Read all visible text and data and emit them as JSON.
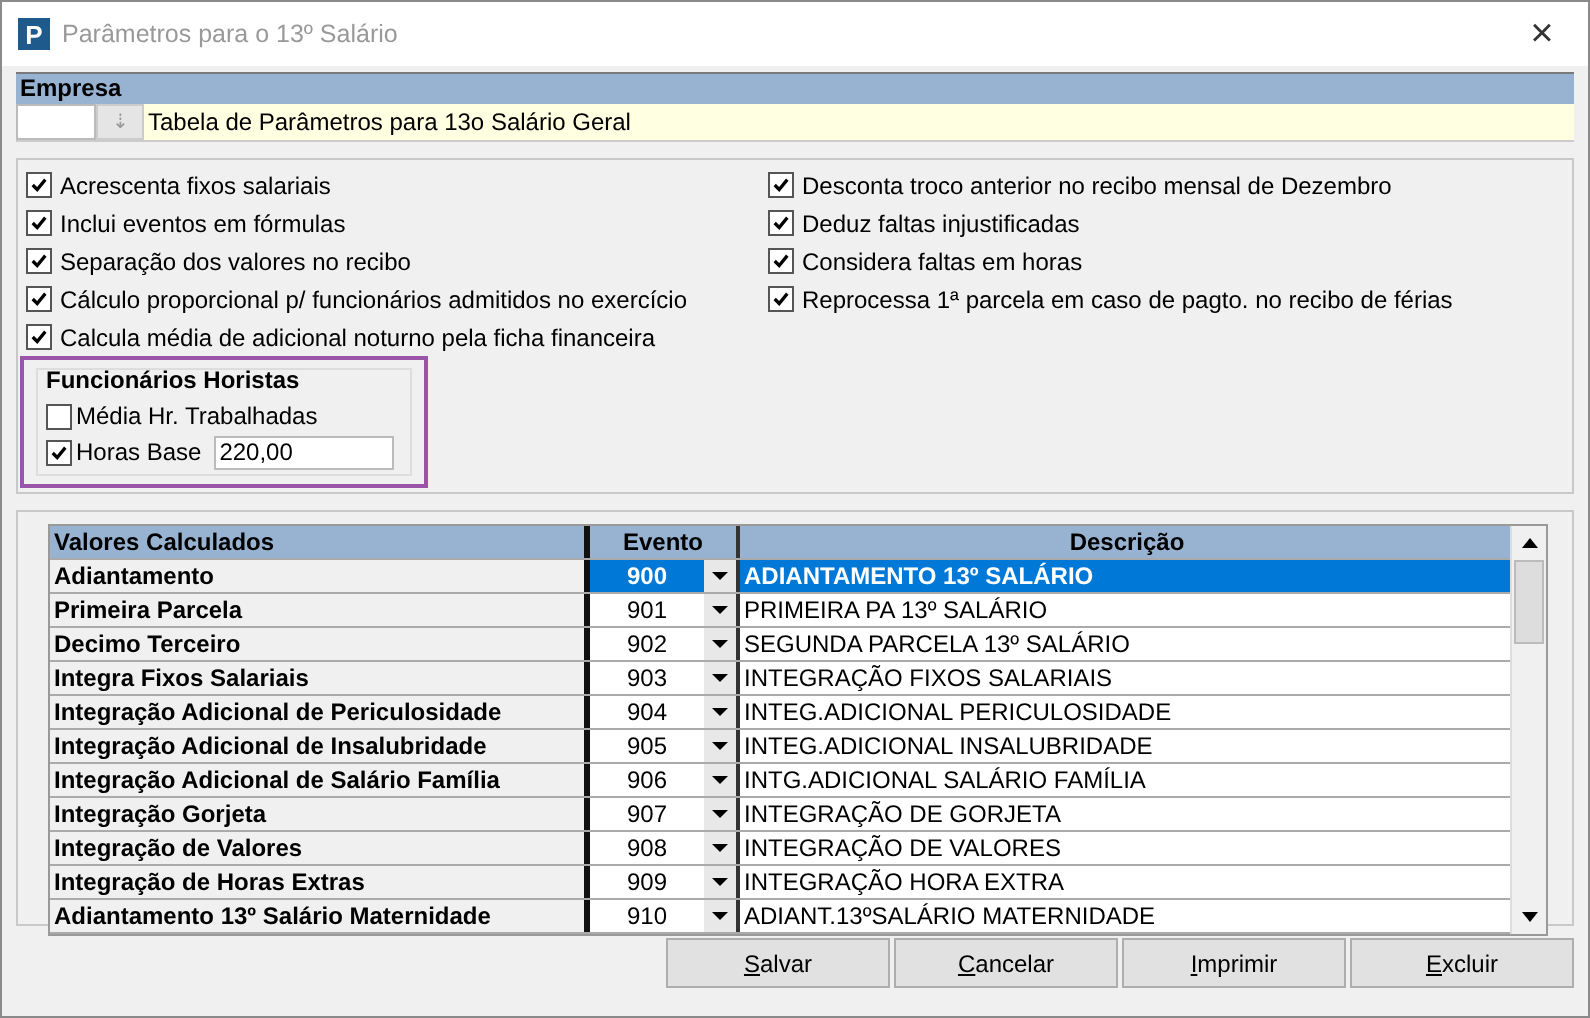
{
  "window": {
    "title": "Parâmetros para o 13º Salário",
    "app_icon": "P",
    "close": "×"
  },
  "empresa": {
    "label": "Empresa",
    "lookup": "⇣",
    "name": "Tabela de Parâmetros para 13o Salário Geral"
  },
  "options_left": [
    {
      "label": "Acrescenta fixos salariais",
      "checked": true
    },
    {
      "label": "Inclui eventos em fórmulas",
      "checked": true
    },
    {
      "label": "Separação dos valores no recibo",
      "checked": true
    },
    {
      "label": "Cálculo proporcional p/ funcionários admitidos no exercício",
      "checked": true
    },
    {
      "label": "Calcula média de adicional noturno pela ficha financeira",
      "checked": true
    }
  ],
  "options_right": [
    {
      "label": "Desconta troco anterior no recibo mensal de Dezembro",
      "checked": true
    },
    {
      "label": "Deduz faltas injustificadas",
      "checked": true
    },
    {
      "label": "Considera faltas em horas",
      "checked": true
    },
    {
      "label": "Reprocessa 1ª parcela em caso de pagto. no recibo de férias",
      "checked": true
    }
  ],
  "horistas": {
    "title": "Funcionários Horistas",
    "media": {
      "label": "Média Hr. Trabalhadas",
      "checked": false
    },
    "horas_base": {
      "label": "Horas Base",
      "checked": true,
      "value": "220,00"
    }
  },
  "table": {
    "columns": [
      "Valores Calculados",
      "Evento",
      "Descrição"
    ],
    "rows": [
      {
        "name": "Adiantamento",
        "evento": "900",
        "descricao": "ADIANTAMENTO 13º SALÁRIO",
        "selected": true
      },
      {
        "name": "Primeira Parcela",
        "evento": "901",
        "descricao": "PRIMEIRA PA 13º SALÁRIO",
        "selected": false
      },
      {
        "name": "Decimo Terceiro",
        "evento": "902",
        "descricao": "SEGUNDA PARCELA 13º SALÁRIO",
        "selected": false
      },
      {
        "name": "Integra Fixos Salariais",
        "evento": "903",
        "descricao": "INTEGRAÇÃO FIXOS SALARIAIS",
        "selected": false
      },
      {
        "name": "Integração Adicional de Periculosidade",
        "evento": "904",
        "descricao": "INTEG.ADICIONAL PERICULOSIDADE",
        "selected": false
      },
      {
        "name": "Integração Adicional de Insalubridade",
        "evento": "905",
        "descricao": "INTEG.ADICIONAL INSALUBRIDADE",
        "selected": false
      },
      {
        "name": "Integração Adicional de Salário Família",
        "evento": "906",
        "descricao": "INTG.ADICIONAL SALÁRIO FAMÍLIA",
        "selected": false
      },
      {
        "name": "Integração Gorjeta",
        "evento": "907",
        "descricao": "INTEGRAÇÃO DE GORJETA",
        "selected": false
      },
      {
        "name": "Integração de Valores",
        "evento": "908",
        "descricao": "INTEGRAÇÃO DE VALORES",
        "selected": false
      },
      {
        "name": "Integração de Horas Extras",
        "evento": "909",
        "descricao": "INTEGRAÇÃO HORA EXTRA",
        "selected": false
      },
      {
        "name": "Adiantamento 13º Salário Maternidade",
        "evento": "910",
        "descricao": "ADIANT.13ºSALÁRIO MATERNIDADE",
        "selected": false
      }
    ]
  },
  "buttons": [
    "Salvar",
    "Cancelar",
    "Imprimir",
    "Excluir"
  ]
}
